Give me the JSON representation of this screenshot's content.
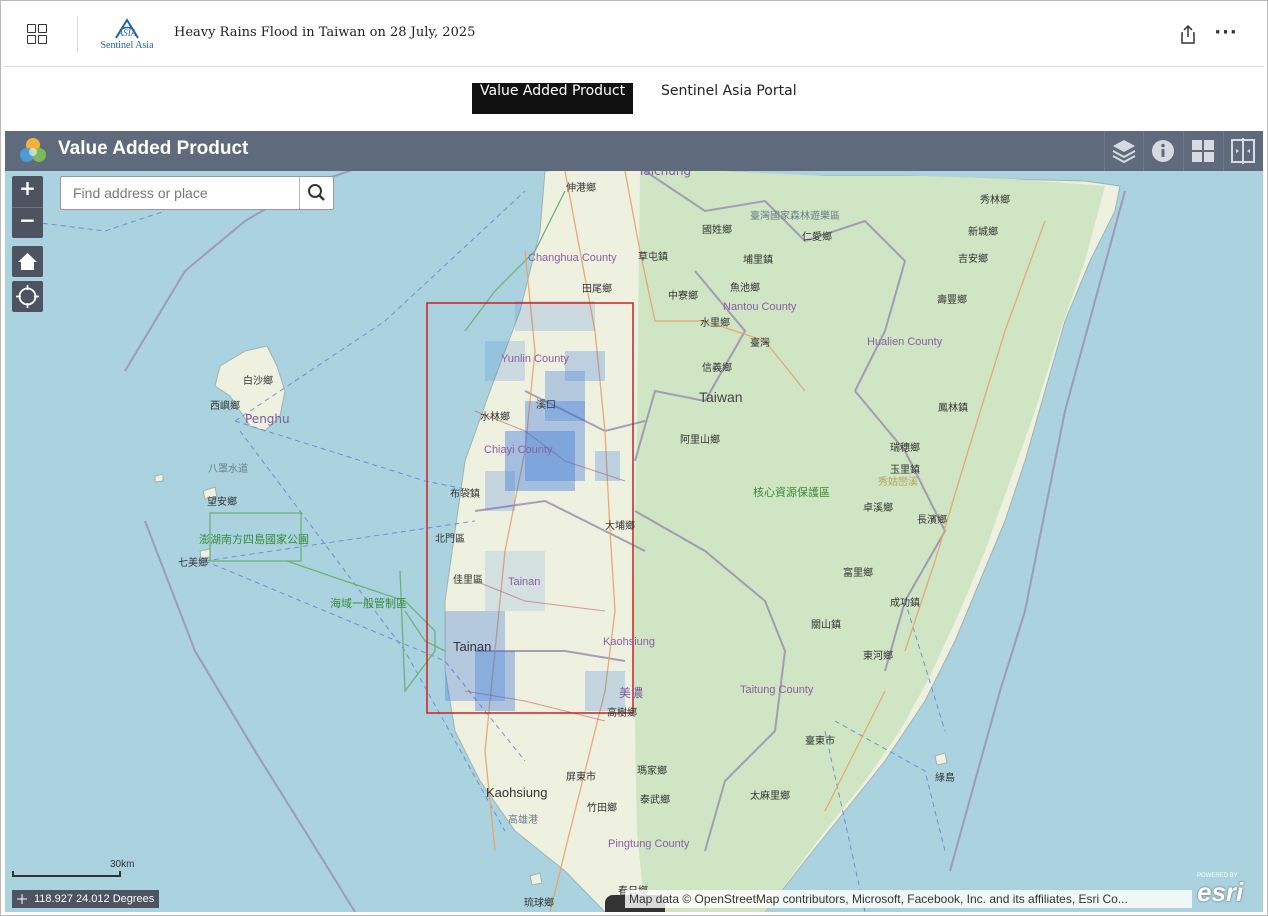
{
  "header": {
    "title": "Heavy Rains Flood in Taiwan on 28 July, 2025",
    "logo_text": "Sentinel Asia",
    "logo_mark": "ASIA"
  },
  "tabs": [
    {
      "label": "Value Added Product",
      "active": true
    },
    {
      "label": "Sentinel Asia Portal",
      "active": false
    }
  ],
  "widget": {
    "title": "Value Added Product"
  },
  "search": {
    "placeholder": "Find address or place"
  },
  "zoom": {
    "in": "+",
    "out": "−"
  },
  "map": {
    "labels": {
      "taichung": "Taichung",
      "shetou": "伸港鄉",
      "changhua": "Changhua County",
      "tianwei": "田尾鄉",
      "tsaotun": "草屯鎮",
      "guoxing": "國姓鄉",
      "forest": "臺灣國家森林遊樂區",
      "renai": "仁愛鄉",
      "puli": "埔里鎮",
      "zhongliao": "中寮鄉",
      "yuchi": "魚池鄉",
      "nantou": "Nantou County",
      "shuili": "水里鄉",
      "taiwan_zh": "臺灣",
      "xinyi": "信義鄉",
      "taiwan": "Taiwan",
      "alishan": "阿里山鄉",
      "yunlin": "Yunlin County",
      "shuilin": "水林鄉",
      "xigang": "溪口",
      "chiayi": "Chiayi County",
      "budai": "布袋鎮",
      "dapu": "大埔鄉",
      "beimen": "北門區",
      "jiali": "佳里區",
      "tainan_zh": "Tainan",
      "tainan": "Tainan",
      "kaohsiung_county": "Kaohsiung",
      "meinong": "美濃",
      "maolin": "高樹鄉",
      "hualien_county": "Hualien County",
      "xiulin": "秀林鄉",
      "xincheng": "新城鄉",
      "jian": "吉安鄉",
      "shoufeng": "壽豐鄉",
      "fenglin": "鳳林鎮",
      "ruisui": "瑞穗鄉",
      "yuli": "玉里鎮",
      "hualien_green": "秀姑巒溪",
      "core_protect": "核心資源保護區",
      "zhuoxi": "卓溪鄉",
      "changbin": "長濱鄉",
      "fuli": "富里鄉",
      "chenggong": "成功鎮",
      "guanshan": "關山鎮",
      "donghe": "東河鄉",
      "taitung_county": "Taitung County",
      "taitung_city": "臺東市",
      "greenisland": "綠島",
      "taimali": "太麻里鄉",
      "pingtung_city": "屏東市",
      "majia": "瑪家鄉",
      "taiwu": "泰武鄉",
      "zhutian": "竹田鄉",
      "kaohsiung": "Kaohsiung",
      "kaohsiung_port": "高雄港",
      "pingtung_county": "Pingtung County",
      "liuqiu": "琉球鄉",
      "chunri": "春日鄉",
      "baisha": "白沙鄉",
      "xiyu": "西嶼鄉",
      "penghu": "Penghu",
      "bazhao": "八罩水道",
      "wangan": "望安鄉",
      "qimei": "七美鄉",
      "penghu_park": "澎湖南方四島國家公園",
      "marine_zone": "海域一般管制區"
    }
  },
  "scale": {
    "label": "30km"
  },
  "coordinates": {
    "text": "118.927 24.012 Degrees"
  },
  "attribution": {
    "text": "Map data © OpenStreetMap contributors, Microsoft, Facebook, Inc. and its affiliates, Esri Co..."
  },
  "esri": {
    "small": "POWERED BY",
    "word": "esri"
  },
  "colors": {
    "widget_bar": "#5f6b7c",
    "water": "#aad3df",
    "flood_points": "#2a6fdb",
    "aoi_box": "#d11f1f"
  }
}
